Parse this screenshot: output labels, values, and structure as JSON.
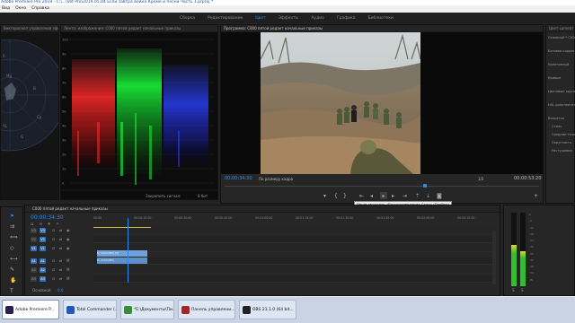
{
  "window": {
    "title": "Adobe Premiere Pro 2019 - C:\\...\\Vet Pro\\2019.05.04 Если завтра война Кроме и песни Часть 1.prproj *"
  },
  "menu": {
    "items": [
      "Вид",
      "Окно",
      "Справка"
    ]
  },
  "workspaces": {
    "tabs": [
      "Сборка",
      "Редактирование",
      "Цвет",
      "Эффекты",
      "Аудио",
      "Графика",
      "Библиотеки"
    ],
    "active": "Цвет"
  },
  "vectorscope": {
    "title": "Вектороскоп управления эффектами",
    "labels": [
      "R",
      "Mg",
      "B",
      "Cy",
      "G",
      "YL"
    ]
  },
  "parade": {
    "title": "Лента: изображения: C000 пятой редакт начальные приказы",
    "ticks": [
      "100",
      "90",
      "80",
      "70",
      "60",
      "50",
      "40",
      "30",
      "20",
      "10",
      "0"
    ],
    "footer_label": "Закрепить сигнал:",
    "bit_depth": "8 бит"
  },
  "program": {
    "title": "Программа: C000 пятой редакт начальные приказы",
    "timecode_in": "00:00:34:30",
    "fit": "По размеру кадра",
    "resolution": "1/2",
    "timecode_duration": "00:00:53:20",
    "tooltip": "Переключатель «Воспроизведение-Стоп» (Пробел)",
    "playhead_fraction": 0.64
  },
  "lumetri": {
    "title": "Цвет Lumetri",
    "items": [
      "Основной * C000",
      "Базовая коррекция",
      "Креативный",
      "Кривые",
      "Цветовые круги",
      "HSL дополнительно",
      "Виньетка",
      "Стиль",
      "Средние точки",
      "Округлость",
      "Растушевка"
    ]
  },
  "timeline": {
    "tab_label": "C000 пятой редакт начальные приказы",
    "timecode": "00:00:34:30",
    "ruler_ticks": [
      "00:00",
      "00:00:15:00",
      "00:00:30:00",
      "00:00:45:00",
      "00:01:00:00",
      "00:01:15:00",
      "00:01:30:00",
      "00:01:45:00",
      "00:02:00:00",
      "00:02:15:00"
    ],
    "tracks": [
      {
        "name": "V3"
      },
      {
        "name": "V2"
      },
      {
        "name": "V1"
      },
      {
        "name": "A1"
      },
      {
        "name": "A2"
      },
      {
        "name": "A3"
      }
    ],
    "master_label": "Основной",
    "master_value": "0,0",
    "clips": [
      {
        "track": "V1",
        "label": "fx  C000.MP4 [V]"
      },
      {
        "track": "A1",
        "label": "fx  C000.MP4"
      }
    ],
    "playhead_fraction": 0.085
  },
  "meters": {
    "scale": [
      "0",
      "-6",
      "-12",
      "-18",
      "-24",
      "-30",
      "-36",
      "-42",
      "-48",
      "-54",
      "dB"
    ],
    "channel_labels": [
      "S",
      "S"
    ],
    "left_level": 0.56,
    "right_level": 0.48
  },
  "taskbar": {
    "items": [
      {
        "label": "Adobe Premiere P...",
        "color": "#2b1f52",
        "active": true
      },
      {
        "label": "Total Commander (...",
        "color": "#2558b5",
        "active": false
      },
      {
        "label": "*E:\\Документы\\Пи...",
        "color": "#3c8b3c",
        "active": false
      },
      {
        "label": "Панель управлени...",
        "color": "#a02828",
        "active": false
      },
      {
        "label": "OBS 21.1.0 (64 bit...",
        "color": "#222222",
        "active": false
      }
    ]
  },
  "colors": {
    "accent": "#2d8ceb",
    "playhead": "#2d8ceb",
    "clip": "#6fa0d8"
  }
}
